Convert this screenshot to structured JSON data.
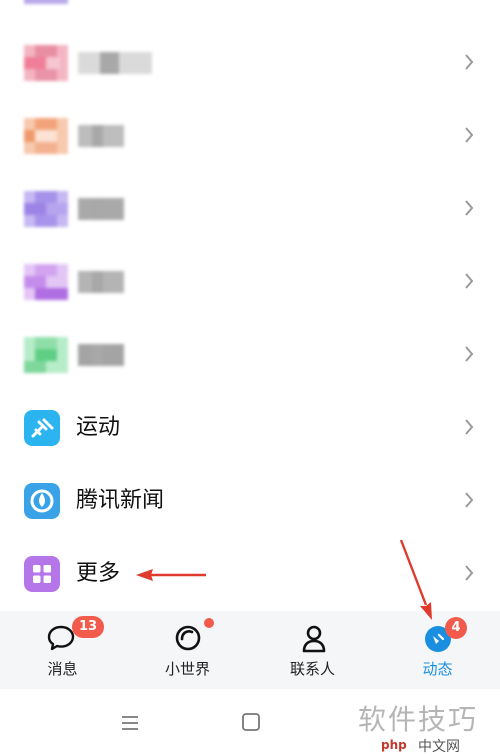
{
  "menu": {
    "items": [
      {
        "label": "运动",
        "icon": "running-app-icon"
      },
      {
        "label": "腾讯新闻",
        "icon": "tencent-news-icon"
      },
      {
        "label": "更多",
        "icon": "more-grid-icon"
      }
    ]
  },
  "tabs": [
    {
      "label": "消息",
      "icon": "message-bubble-icon",
      "badge": "13"
    },
    {
      "label": "小世界",
      "icon": "small-world-icon",
      "badge": ""
    },
    {
      "label": "联系人",
      "icon": "contacts-person-icon",
      "badge": ""
    },
    {
      "label": "动态",
      "icon": "feed-dynamic-icon",
      "badge": "4"
    }
  ],
  "active_tab": "动态",
  "colors": {
    "accent": "#1a8fe0",
    "badge": "#f25a4b",
    "annotation_arrow": "#e03a2f",
    "tab_bar_bg": "#f5f6f8"
  },
  "watermark": {
    "main": "软件技巧",
    "logo": "php",
    "site": "中文网"
  }
}
